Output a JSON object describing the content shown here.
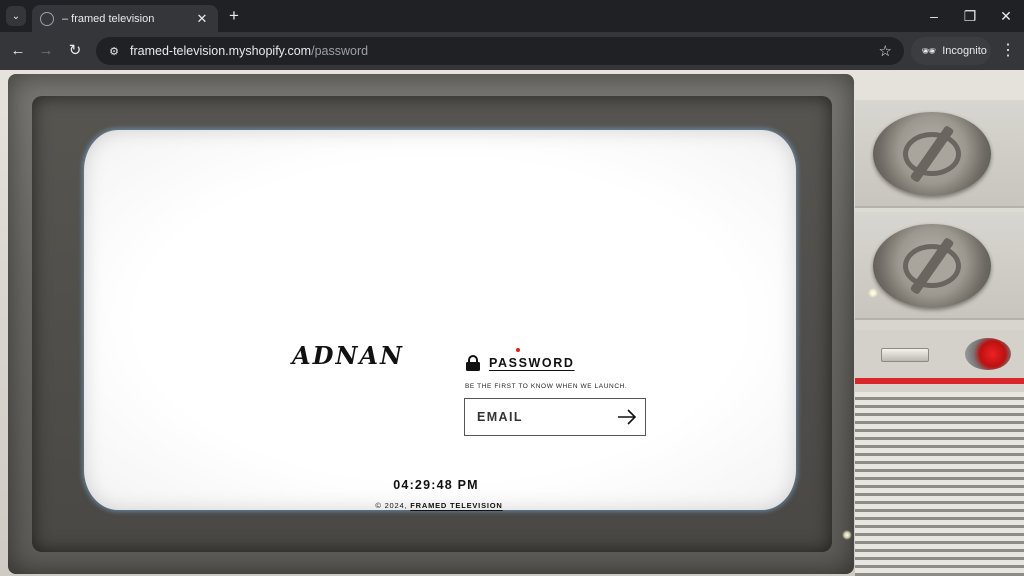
{
  "browser": {
    "tab_title": "– framed television",
    "url_host": "framed-television.myshopify.com",
    "url_path": "/password",
    "incognito_label": "Incognito",
    "icons": {
      "tab_search": "chevron-down-icon",
      "favicon": "globe-icon",
      "tab_close": "close-icon",
      "new_tab": "plus-icon",
      "back": "arrow-left-icon",
      "forward": "arrow-right-icon",
      "reload": "reload-icon",
      "site_info": "tune-icon",
      "bookmark": "star-icon",
      "incognito": "incognito-icon",
      "menu": "kebab-menu-icon",
      "minimize": "minimize-icon",
      "restore": "restore-icon",
      "close_window": "close-icon"
    }
  },
  "page": {
    "logo_text": "ADNAN",
    "password_label": "PASSWORD",
    "tagline": "BE THE FIRST TO KNOW WHEN WE LAUNCH.",
    "email_placeholder": "EMAIL",
    "clock": "04:29:48 PM",
    "footer_prefix": "© 2024,",
    "footer_link": "FRAMED TELEVISION",
    "colors": {
      "screen": "#ffffff",
      "text": "#111111",
      "accent_red": "#d8262a",
      "tv_bezel": "#6b6964"
    }
  }
}
